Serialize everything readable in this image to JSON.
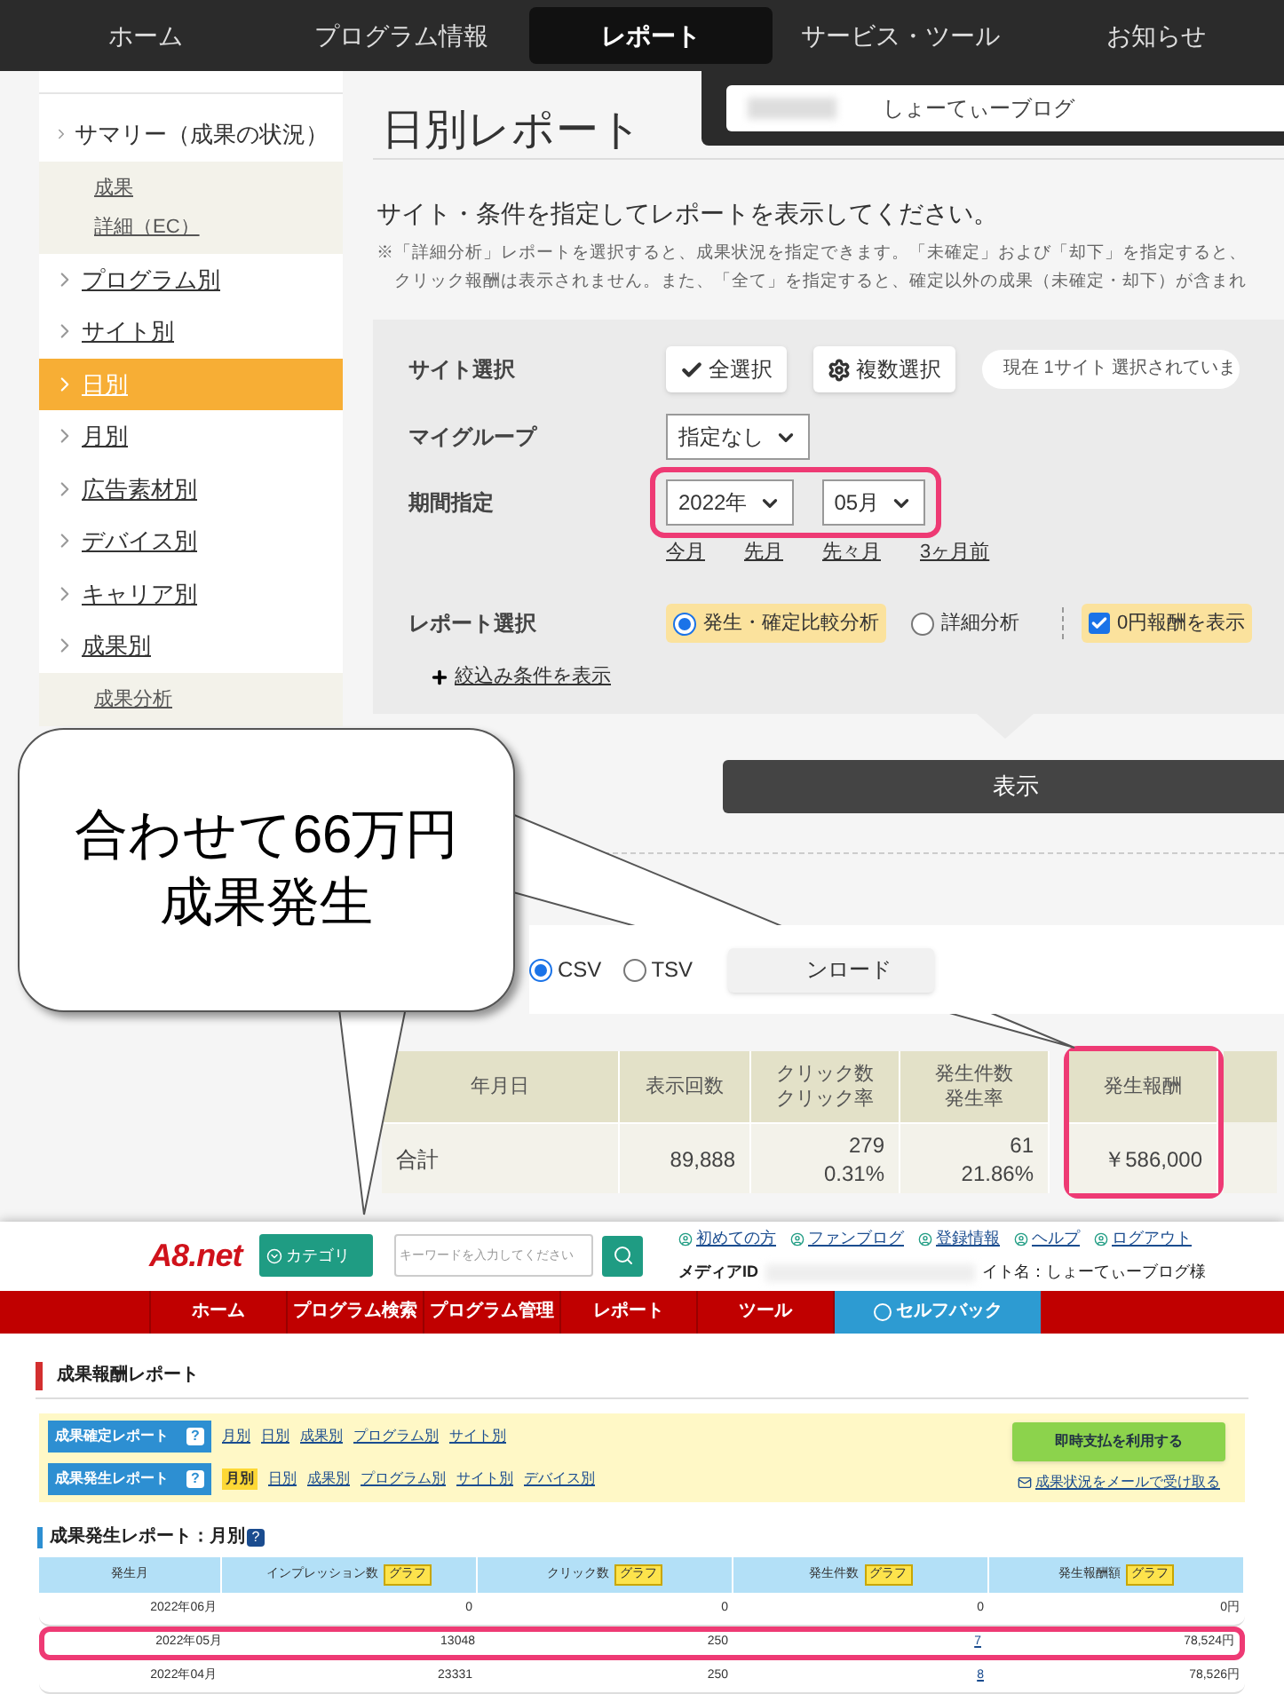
{
  "top_nav": [
    {
      "label": "ホーム",
      "selected": false
    },
    {
      "label": "プログラム情報",
      "selected": false
    },
    {
      "label": "レポート",
      "selected": true
    },
    {
      "label": "サービス・ツール",
      "selected": false
    },
    {
      "label": "お知らせ",
      "selected": false
    }
  ],
  "sidebar": {
    "items": [
      {
        "label": "サマリー（成果の状況）",
        "selected": false,
        "children": [
          {
            "label": "成果"
          },
          {
            "label": "詳細（EC）"
          }
        ]
      },
      {
        "label": "プログラム別",
        "selected": false
      },
      {
        "label": "サイト別",
        "selected": false
      },
      {
        "label": "日別",
        "selected": true
      },
      {
        "label": "月別",
        "selected": false
      },
      {
        "label": "広告素材別",
        "selected": false
      },
      {
        "label": "デバイス別",
        "selected": false
      },
      {
        "label": "キャリア別",
        "selected": false
      },
      {
        "label": "成果別",
        "selected": false,
        "children": [
          {
            "label": "成果分析"
          }
        ]
      }
    ]
  },
  "site_picker": {
    "value": "しょーてぃーブログ"
  },
  "page_title": "日別レポート",
  "instruction": "サイト・条件を指定してレポートを表示してください。",
  "notes": [
    "※「詳細分析」レポートを選択すると、成果状況を指定できます。「未確定」および「却下」を指定すると、",
    "クリック報酬は表示されません。また、「全て」を指定すると、確定以外の成果（未確定・却下）が含まれ"
  ],
  "form": {
    "site_select": {
      "label": "サイト選択",
      "buttons": [
        {
          "kind": "check",
          "label": "全選択"
        },
        {
          "kind": "gear",
          "label": "複数選択"
        }
      ],
      "status": "現在 1サイト 選択されていま"
    },
    "my_group": {
      "label": "マイグループ",
      "value": "指定なし"
    },
    "period": {
      "label": "期間指定",
      "year": "2022年",
      "month": "05月",
      "highlighted": true,
      "shortcuts": [
        "今月",
        "先月",
        "先々月",
        "3ヶ月前"
      ]
    },
    "report_select": {
      "label": "レポート選択",
      "options": [
        {
          "label": "発生・確定比較分析",
          "selected": true
        },
        {
          "label": "詳細分析",
          "selected": false
        }
      ],
      "zero_reward": {
        "label": "0円報酬を表示",
        "checked": true
      }
    },
    "filter_link": "絞込み条件を表示"
  },
  "show_button": "表示",
  "export": {
    "formats": [
      {
        "label": "CSV",
        "selected": true
      },
      {
        "label": "TSV",
        "selected": false
      }
    ],
    "download_button": "ンロード"
  },
  "report_table": {
    "columns": [
      {
        "header": [
          "年月日"
        ],
        "total": [
          "合計"
        ],
        "highlighted": false
      },
      {
        "header": [
          "表示回数"
        ],
        "total": [
          "89,888"
        ],
        "highlighted": false
      },
      {
        "header": [
          "クリック数",
          "クリック率"
        ],
        "total": [
          "279",
          "0.31%"
        ],
        "highlighted": false
      },
      {
        "header": [
          "発生件数",
          "発生率"
        ],
        "total": [
          "61",
          "21.86%"
        ],
        "highlighted": false
      },
      {
        "header": [
          "発生報酬"
        ],
        "total": [
          "￥586,000"
        ],
        "highlighted": true
      }
    ]
  },
  "callout": {
    "lines": [
      "合わせて66万円",
      "成果発生"
    ]
  },
  "a8": {
    "logo": "A8.net",
    "category_button": "カテゴリ",
    "search_placeholder": "キーワードを入力してください",
    "links": [
      "初めての方",
      "ファンブログ",
      "登録情報",
      "ヘルプ",
      "ログアウト"
    ],
    "media_id_label": "メディアID",
    "site_name": "イト名：しょーてぃーブログ様",
    "nav": [
      {
        "label": "ホーム",
        "kind": "plain"
      },
      {
        "label": "プログラム検索",
        "kind": "plain"
      },
      {
        "label": "プログラム管理",
        "kind": "plain"
      },
      {
        "label": "レポート",
        "kind": "plain"
      },
      {
        "label": "ツール",
        "kind": "plain"
      },
      {
        "label": "セルフバック",
        "kind": "selfback"
      }
    ],
    "section_title": "成果報酬レポート",
    "report_groups": [
      {
        "label": "成果確定レポート",
        "help": "?",
        "links": [
          {
            "label": "月別",
            "selected": false
          },
          {
            "label": "日別",
            "selected": false
          },
          {
            "label": "成果別",
            "selected": false
          },
          {
            "label": "プログラム別",
            "selected": false
          },
          {
            "label": "サイト別",
            "selected": false
          }
        ]
      },
      {
        "label": "成果発生レポート",
        "help": "?",
        "links": [
          {
            "label": "月別",
            "selected": true
          },
          {
            "label": "日別",
            "selected": false
          },
          {
            "label": "成果別",
            "selected": false
          },
          {
            "label": "プログラム別",
            "selected": false
          },
          {
            "label": "サイト別",
            "selected": false
          },
          {
            "label": "デバイス別",
            "selected": false
          }
        ]
      }
    ],
    "instant_pay_button": "即時支払を利用する",
    "mail_link": "成果状況をメールで受け取る",
    "table_title": "成果発生レポート：月別",
    "table_help": "?",
    "table": {
      "columns": [
        {
          "label": "発生月"
        },
        {
          "label": "インプレッション数",
          "badge": "グラフ"
        },
        {
          "label": "クリック数",
          "badge": "グラフ"
        },
        {
          "label": "発生件数",
          "badge": "グラフ"
        },
        {
          "label": "発生報酬額",
          "badge": "グラフ"
        }
      ],
      "rows": [
        {
          "cells": [
            "2022年06月",
            "0",
            "0",
            "0",
            "0円"
          ],
          "count_linked": false,
          "highlighted": false
        },
        {
          "cells": [
            "2022年05月",
            "13048",
            "250",
            "7",
            "78,524円"
          ],
          "count_linked": true,
          "highlighted": true
        },
        {
          "cells": [
            "2022年04月",
            "23331",
            "250",
            "8",
            "78,526円"
          ],
          "count_linked": true,
          "highlighted": false
        }
      ]
    }
  }
}
